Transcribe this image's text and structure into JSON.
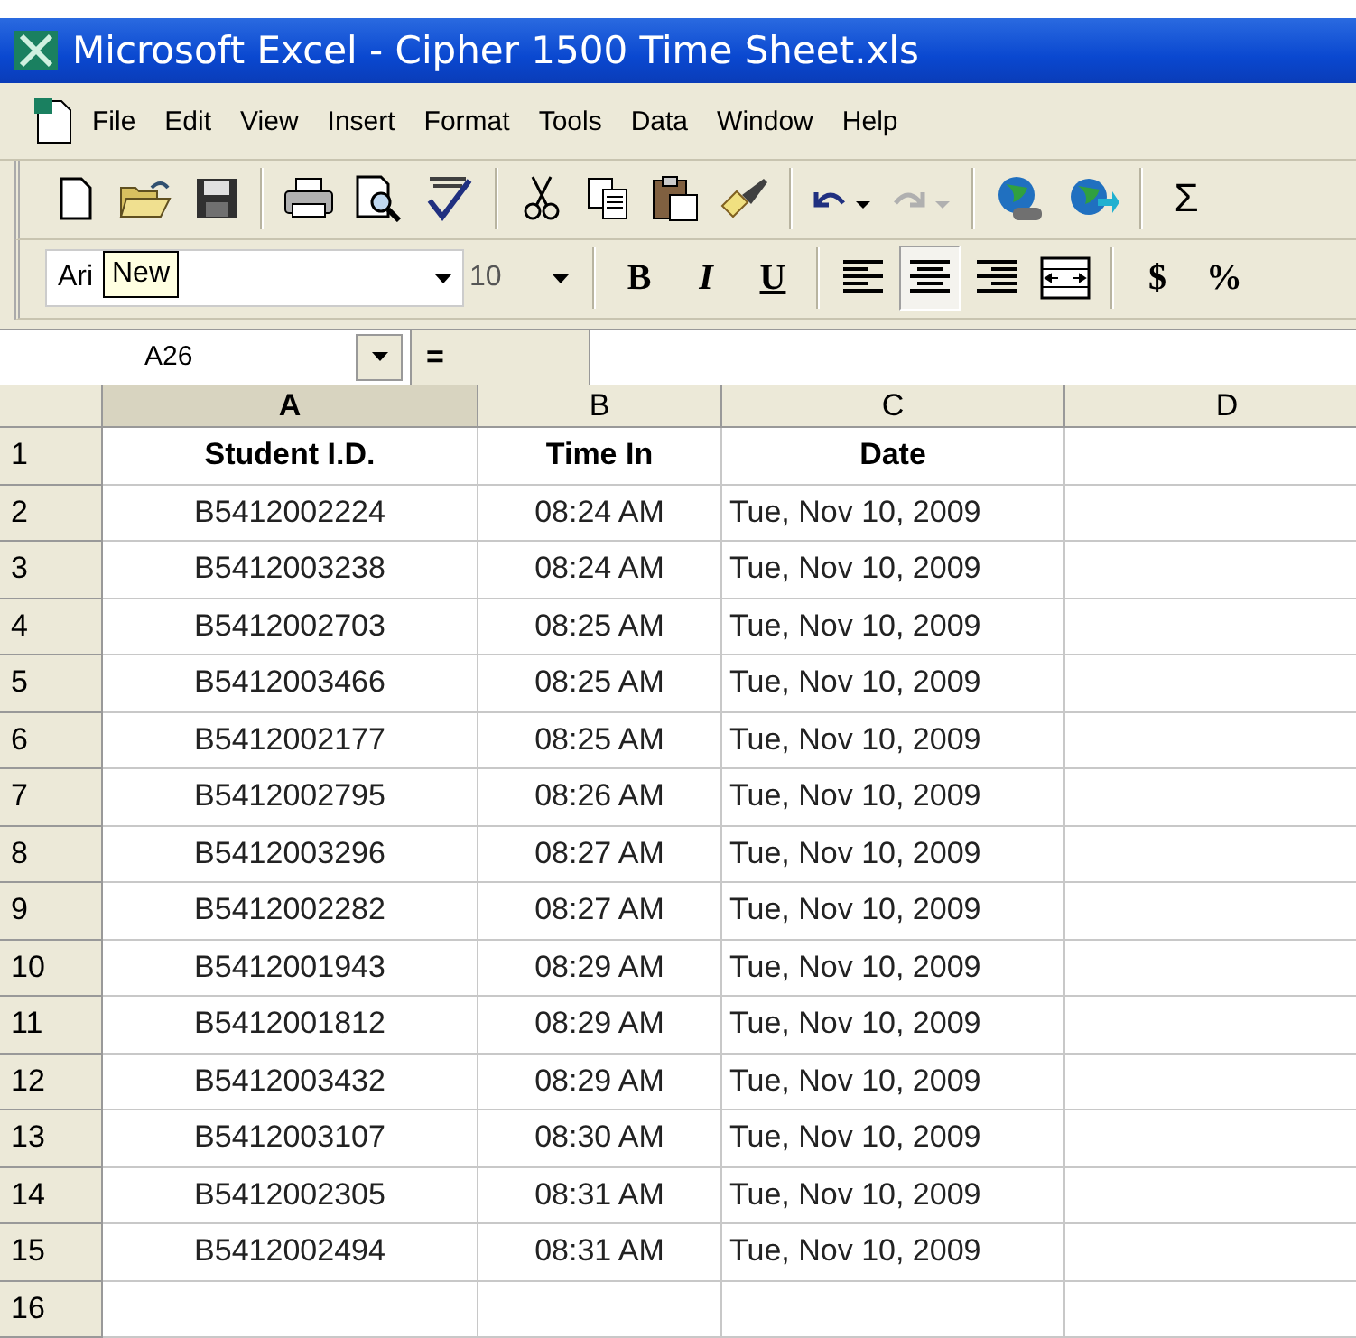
{
  "window": {
    "title": "Microsoft Excel - Cipher 1500 Time Sheet.xls"
  },
  "menu": [
    {
      "label": "File",
      "selected": false
    },
    {
      "label": "Edit",
      "selected": false
    },
    {
      "label": "View",
      "selected": false
    },
    {
      "label": "Insert",
      "selected": false
    },
    {
      "label": "Format",
      "selected": false
    },
    {
      "label": "Tools",
      "selected": false
    },
    {
      "label": "Data",
      "selected": false
    },
    {
      "label": "Window",
      "selected": false
    },
    {
      "label": "Help",
      "selected": false
    }
  ],
  "standard_toolbar": [
    {
      "kind": "new"
    },
    {
      "kind": "open"
    },
    {
      "kind": "save"
    },
    {
      "kind": "sep"
    },
    {
      "kind": "print"
    },
    {
      "kind": "preview"
    },
    {
      "kind": "spelling"
    },
    {
      "kind": "sep"
    },
    {
      "kind": "cut"
    },
    {
      "kind": "copy"
    },
    {
      "kind": "paste"
    },
    {
      "kind": "brush"
    },
    {
      "kind": "sep"
    },
    {
      "kind": "undo",
      "disabled": false
    },
    {
      "kind": "redo",
      "disabled": true
    },
    {
      "kind": "sep"
    },
    {
      "kind": "globe"
    },
    {
      "kind": "globe-arrows"
    },
    {
      "kind": "sep"
    },
    {
      "kind": "text",
      "label": "Σ"
    }
  ],
  "formatting_toolbar": {
    "font": {
      "value": "Ari"
    },
    "tooltip": "New",
    "size": {
      "value": "10"
    },
    "buttons": [
      {
        "kind": "bold",
        "label": "B",
        "selected": false
      },
      {
        "kind": "italic",
        "label": "I",
        "selected": false
      },
      {
        "kind": "underline",
        "label": "U",
        "selected": false
      },
      {
        "kind": "sep"
      },
      {
        "kind": "align-left",
        "selected": false
      },
      {
        "kind": "align-center",
        "selected": true
      },
      {
        "kind": "align-right",
        "selected": false
      },
      {
        "kind": "merge",
        "selected": false
      },
      {
        "kind": "sep"
      },
      {
        "kind": "currency",
        "label": "$",
        "selected": false
      },
      {
        "kind": "percent",
        "label": "%",
        "selected": false
      }
    ]
  },
  "formula_bar": {
    "name_box": "A26",
    "equals": "="
  },
  "sheet": {
    "columns": [
      {
        "label": "A",
        "selected": true
      },
      {
        "label": "B",
        "selected": false
      },
      {
        "label": "C",
        "selected": false
      },
      {
        "label": "D",
        "selected": false
      }
    ],
    "rows": [
      {
        "number": "1",
        "cells": [
          "Student I.D.",
          "Time In",
          "Date",
          ""
        ],
        "header": true
      },
      {
        "number": "2",
        "cells": [
          "B5412002224",
          "08:24 AM",
          "Tue, Nov 10, 2009",
          ""
        ],
        "header": false
      },
      {
        "number": "3",
        "cells": [
          "B5412003238",
          "08:24 AM",
          "Tue, Nov 10, 2009",
          ""
        ],
        "header": false
      },
      {
        "number": "4",
        "cells": [
          "B5412002703",
          "08:25 AM",
          "Tue, Nov 10, 2009",
          ""
        ],
        "header": false
      },
      {
        "number": "5",
        "cells": [
          "B5412003466",
          "08:25 AM",
          "Tue, Nov 10, 2009",
          ""
        ],
        "header": false
      },
      {
        "number": "6",
        "cells": [
          "B5412002177",
          "08:25 AM",
          "Tue, Nov 10, 2009",
          ""
        ],
        "header": false
      },
      {
        "number": "7",
        "cells": [
          "B5412002795",
          "08:26 AM",
          "Tue, Nov 10, 2009",
          ""
        ],
        "header": false
      },
      {
        "number": "8",
        "cells": [
          "B5412003296",
          "08:27 AM",
          "Tue, Nov 10, 2009",
          ""
        ],
        "header": false
      },
      {
        "number": "9",
        "cells": [
          "B5412002282",
          "08:27 AM",
          "Tue, Nov 10, 2009",
          ""
        ],
        "header": false
      },
      {
        "number": "10",
        "cells": [
          "B5412001943",
          "08:29 AM",
          "Tue, Nov 10, 2009",
          ""
        ],
        "header": false
      },
      {
        "number": "11",
        "cells": [
          "B5412001812",
          "08:29 AM",
          "Tue, Nov 10, 2009",
          ""
        ],
        "header": false
      },
      {
        "number": "12",
        "cells": [
          "B5412003432",
          "08:29 AM",
          "Tue, Nov 10, 2009",
          ""
        ],
        "header": false
      },
      {
        "number": "13",
        "cells": [
          "B5412003107",
          "08:30 AM",
          "Tue, Nov 10, 2009",
          ""
        ],
        "header": false
      },
      {
        "number": "14",
        "cells": [
          "B5412002305",
          "08:31 AM",
          "Tue, Nov 10, 2009",
          ""
        ],
        "header": false
      },
      {
        "number": "15",
        "cells": [
          "B5412002494",
          "08:31 AM",
          "Tue, Nov 10, 2009",
          ""
        ],
        "header": false
      },
      {
        "number": "16",
        "cells": [
          "",
          "",
          "",
          ""
        ]
      }
    ]
  }
}
